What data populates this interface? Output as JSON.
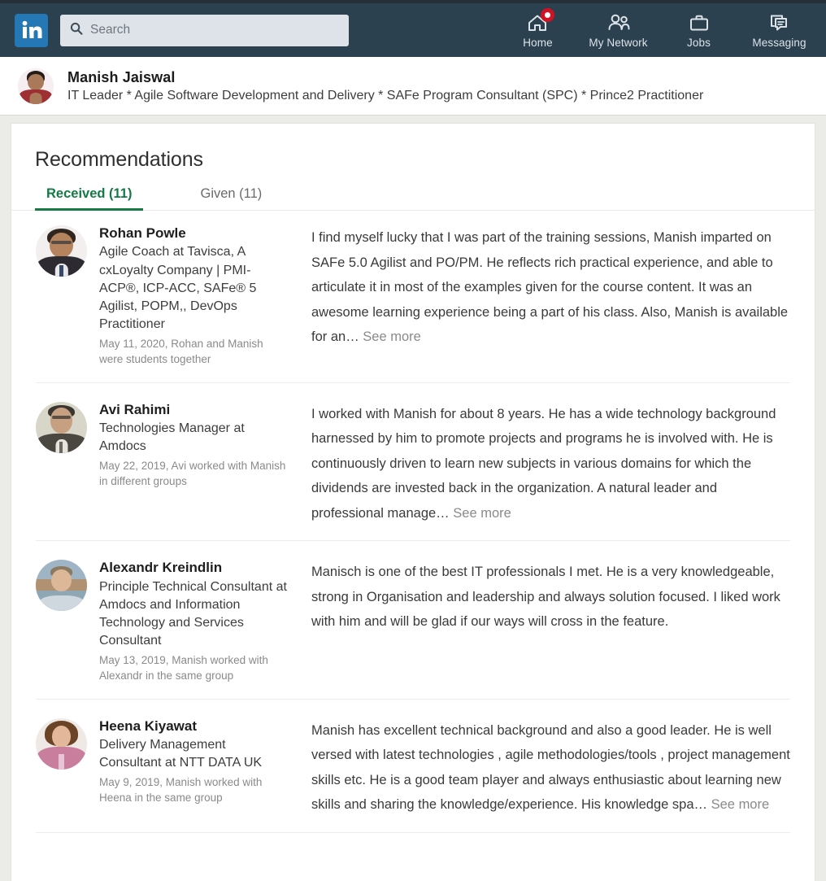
{
  "colors": {
    "nav_bg": "#2b414f",
    "nav_top_strip": "#242f38",
    "brand_blue": "#2478b5",
    "badge_red": "#d11124",
    "accent_green": "#157a46",
    "page_bg": "#ebebe8",
    "card_bg": "#ffffff"
  },
  "navbar": {
    "logo_text": "in",
    "logo_icon": "linkedin-logo-icon",
    "search": {
      "icon": "search-icon",
      "placeholder": "Search",
      "value": ""
    },
    "items": [
      {
        "label": "Home",
        "icon": "home-icon",
        "badge": true
      },
      {
        "label": "My Network",
        "icon": "network-people-icon",
        "badge": false
      },
      {
        "label": "Jobs",
        "icon": "briefcase-icon",
        "badge": false
      },
      {
        "label": "Messaging",
        "icon": "messaging-chat-icon",
        "badge": false
      }
    ]
  },
  "profile_bar": {
    "avatar": "profile-avatar",
    "name": "Manish Jaiswal",
    "headline": "IT Leader * Agile Software Development and Delivery * SAFe Program Consultant (SPC) * Prince2 Practitioner"
  },
  "section": {
    "title": "Recommendations",
    "tabs": [
      {
        "label": "Received (11)",
        "active": true
      },
      {
        "label": "Given (11)",
        "active": false
      }
    ]
  },
  "recommendations": [
    {
      "name": "Rohan Powle",
      "role": "Agile Coach at Tavisca, A cxLoyalty Company | PMI-ACP®, ICP-ACC, SAFe® 5 Agilist, POPM,, DevOps Practitioner",
      "date": "May 11, 2020, Rohan and Manish were students together",
      "text": "I find myself lucky that I was part of the training sessions, Manish imparted on SAFe 5.0 Agilist and PO/PM. He reflects rich practical experience, and able to articulate it in most of the examples given for the course content. It was an awesome learning experience being a part of his class. Also, Manish is available for an…",
      "see_more": "See more",
      "has_see_more": true
    },
    {
      "name": "Avi Rahimi",
      "role": "Technologies Manager at Amdocs",
      "date": "May 22, 2019, Avi worked with Manish in different groups",
      "text": "I worked with Manish for about 8 years. He has a wide technology background harnessed by him to promote projects and programs he is involved with. He is continuously driven to learn new subjects in various domains for which the dividends are invested back in the organization. A natural leader and professional manage…",
      "see_more": "See more",
      "has_see_more": true
    },
    {
      "name": "Alexandr Kreindlin",
      "role": "Principle Technical Consultant at Amdocs and Information Technology and Services Consultant",
      "date": "May 13, 2019, Manish worked with Alexandr in the same group",
      "text": "Manisch is one of the best IT professionals I met. He is a very knowledgeable, strong in Organisation and leadership and always solution focused. I liked work with him and will be glad if our ways will cross in the feature.",
      "see_more": "",
      "has_see_more": false
    },
    {
      "name": "Heena Kiyawat",
      "role": "Delivery Management Consultant at NTT DATA UK",
      "date": "May 9, 2019, Manish worked with Heena in the same group",
      "text": "Manish has excellent technical background and also a good leader. He is well versed with latest technologies , agile methodologies/tools , project management skills etc. He is a good team player and always enthusiastic about learning new skills and sharing the knowledge/experience. His knowledge spa…",
      "see_more": "See more",
      "has_see_more": true
    }
  ]
}
